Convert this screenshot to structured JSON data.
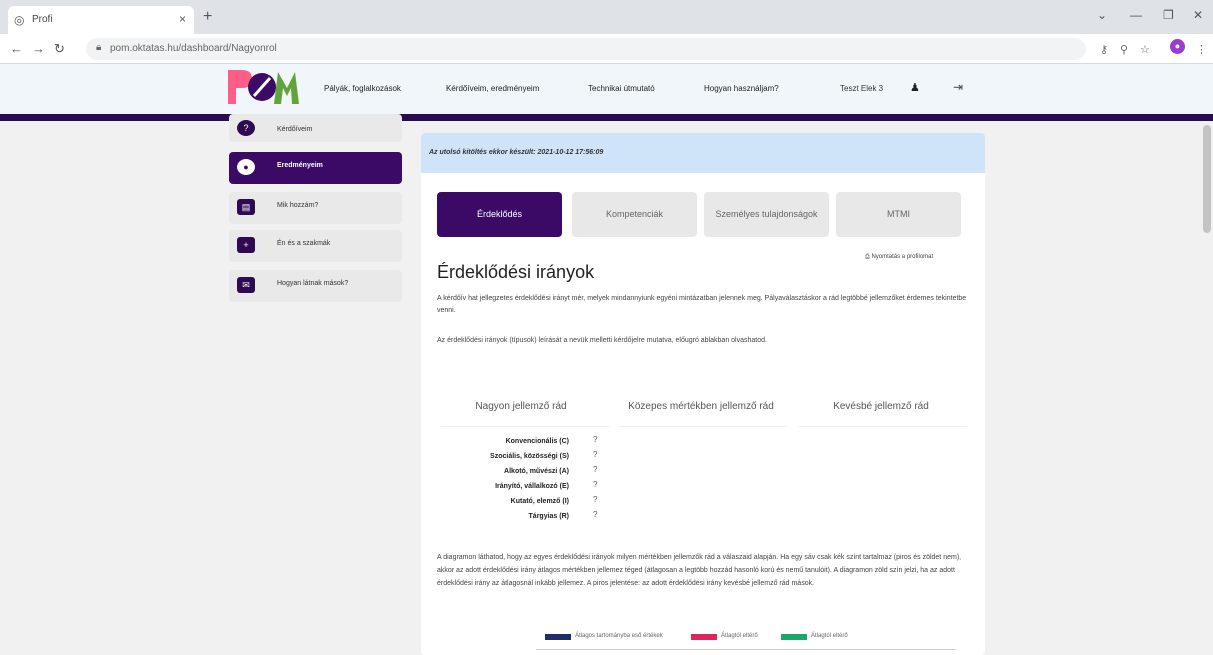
{
  "browser": {
    "tab_title": "Profi",
    "url": "pom.oktatas.hu/dashboard/Nagyonrol"
  },
  "header": {
    "nav": [
      "Pályák, foglalkozások",
      "Kérdőíveim, eredményeim",
      "Technikai útmutató",
      "Hogyan használjam?"
    ],
    "user": "Teszt Elek 3"
  },
  "sidebar": {
    "items": [
      {
        "label": "Kérdőíveim"
      },
      {
        "label": "Eredményeim"
      },
      {
        "label": "Mik hozzám?"
      },
      {
        "label": "Én és a szakmák"
      },
      {
        "label": "Hogyan látnak mások?"
      }
    ]
  },
  "main": {
    "banner": "Az utolsó kitöltés ekkor készült: 2021-10-12 17:56:09",
    "tabs": [
      "Érdeklődés",
      "Kompetenciák",
      "Személyes tulajdonságok",
      "MTMI"
    ],
    "print_link": "Nyomtatás a profilomat",
    "section_title": "Érdeklődési irányok",
    "intro_1": "A kérdőív hat jellegzetes érdeklődési irányt mér, melyek mindannyiunk egyéni mintázatban jelennek meg. Pályaválasztáskor a rád legtöbbé jellemzőket érdemes tekintetbe venni.",
    "intro_2": "Az érdeklődési irányok (típusok) leírását a nevük melletti kérdőjelre mutatva, előugró ablakban olvashatod.",
    "columns": [
      "Nagyon jellemző rád",
      "Közepes mértékben jellemző rád",
      "Kevésbé jellemző rád"
    ],
    "types": [
      "Konvencionális (C)",
      "Szociális, közösségi (S)",
      "Alkotó, művészi (A)",
      "Irányító, vállalkozó (E)",
      "Kutató, elemző (I)",
      "Tárgyias (R)"
    ],
    "help_glyph": "?",
    "explanation": "A diagramon láthatod, hogy az egyes érdeklődési irányok milyen mértékben jellemzők rád a válaszaid alapján. Ha egy sáv csak kék színt tartalmaz (piros és zöldet nem), akkor az adott érdeklődési irány átlagos mértékben jellemez téged (átlagosan a legtöbb hozzád hasonló korú és nemű tanulóit). A diagramon zöld szín jelzi, ha az adott érdeklődési irány az átlagosnál inkább jellemez. A piros jelentése: az adott érdeklődési irány kevésbé jellemző rád mások.",
    "legend": [
      {
        "label": "Átlagos tartományba eső értékek",
        "color": "#1f2d6b"
      },
      {
        "label": "Átlagtól eltérő",
        "color": "#e0245e"
      },
      {
        "label": "Átlagtól eltérő",
        "color": "#1aa86a"
      }
    ]
  },
  "colors": {
    "accent": "#3a0a66",
    "banner": "#cfe4f8"
  }
}
